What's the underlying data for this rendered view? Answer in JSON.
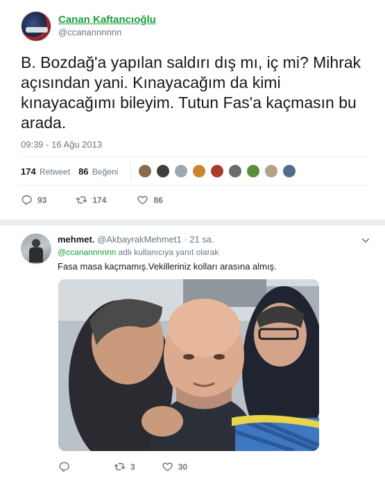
{
  "main_tweet": {
    "display_name": "Canan Kaftancıoğlu",
    "screen_name": "@ccanannnnnn",
    "text": "B. Bozdağ'a yapılan saldırı dış mı, iç mi? Mihrak açısından yani. Kınayacağım da kimi kınayacağımı bileyim. Tutun Fas'a kaçmasın bu arada.",
    "timestamp": "09:39 - 16 Ağu 2013",
    "stats": {
      "retweet_count": "174",
      "retweet_label": "Retweet",
      "like_count": "86",
      "like_label": "Beğeni"
    },
    "actions": {
      "reply_count": "93",
      "retweet_count": "174",
      "like_count": "86"
    }
  },
  "likers": [
    {
      "icon": "avatar",
      "color": "#8a6a4a"
    },
    {
      "icon": "avatar",
      "color": "#3f3f3f"
    },
    {
      "icon": "avatar",
      "color": "#9aa6b2"
    },
    {
      "icon": "avatar",
      "color": "#c7862e"
    },
    {
      "icon": "avatar",
      "color": "#a83a2e"
    },
    {
      "icon": "avatar",
      "color": "#6b6b6b"
    },
    {
      "icon": "avatar",
      "color": "#5a8f3a"
    },
    {
      "icon": "avatar",
      "color": "#b5a18c"
    },
    {
      "icon": "avatar",
      "color": "#4e6e8e"
    }
  ],
  "reply": {
    "display_name": "mehmet.",
    "screen_name": "@AkbayrakMehmet1",
    "time": "· 21 sa.",
    "mention": "@ccanannnnnn",
    "context": "adlı kullanıcıya yanıt olarak",
    "text": "Fasa masa kaçmamış.Vekilleriniz kolları arasına almış.",
    "actions": {
      "reply_count": "",
      "retweet_count": "3",
      "like_count": "30"
    }
  },
  "colors": {
    "accent_green": "#1a9e3a",
    "secondary_text": "#657786",
    "divider": "#e6ecf0"
  }
}
